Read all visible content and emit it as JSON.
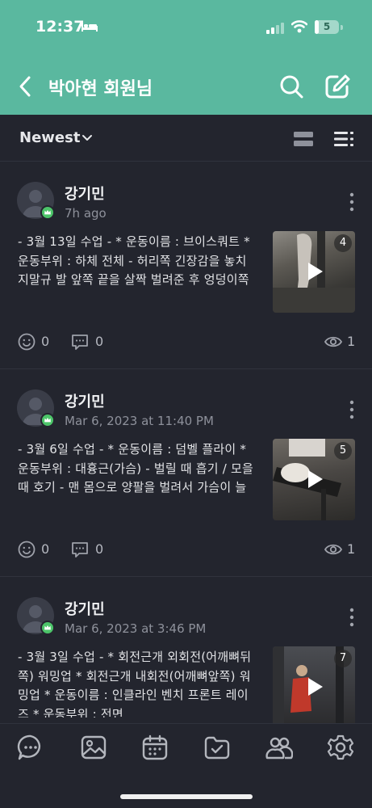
{
  "status": {
    "time": "12:37",
    "battery": "5",
    "battery_level": 0.15
  },
  "header": {
    "title": "박아현 회원님"
  },
  "toolbar": {
    "sort_label": "Newest"
  },
  "posts": [
    {
      "author": "강기민",
      "time": "7h ago",
      "excerpt": "- 3월 13일 수업 - * 운동이름 : 브이스쿼트 * 운동부위 : 하체 전체 - 허리쪽 긴장감을 놓치지말규 발 앞쪽 끝을 살짝 벌려준 후 엉덩이쪽에서 받쳐진다는 느…",
      "media_count": "4",
      "reactions": "0",
      "comments": "0",
      "views": "1"
    },
    {
      "author": "강기민",
      "time": "Mar 6, 2023 at 11:40 PM",
      "excerpt": "- 3월 6일 수업 - * 운동이름 : 덤벨 플라이 * 운동부위 : 대흉근(가슴) - 벌릴 때 흡기 / 모을 때 호기 - 맨 몸으로 양팔을 벌려서 가슴이 늘어나는 느낌이 나…",
      "media_count": "5",
      "reactions": "0",
      "comments": "0",
      "views": "1"
    },
    {
      "author": "강기민",
      "time": "Mar 6, 2023 at 3:46 PM",
      "excerpt": "- 3월 3일 수업 - * 회전근개 외회전(어깨뼈뒤쪽) 워밍업 * 회전근개 내회전(어깨뼈앞쪽) 워밍업 * 운동이름 : 인클라인 벤치 프론트 레이즈 * 운동부위 : 전면",
      "media_count": "7"
    }
  ],
  "colors": {
    "header_bg": "#5ab89f",
    "background": "#23252e",
    "badge": "#4cc469"
  },
  "icons": [
    "back-arrow-icon",
    "search-icon",
    "edit-icon",
    "chevron-down-icon",
    "card-view-icon",
    "list-view-icon",
    "more-icon",
    "play-icon",
    "smiley-icon",
    "comment-icon",
    "eye-icon",
    "chat-icon",
    "image-icon",
    "calendar-icon",
    "folder-check-icon",
    "people-icon",
    "settings-icon"
  ]
}
